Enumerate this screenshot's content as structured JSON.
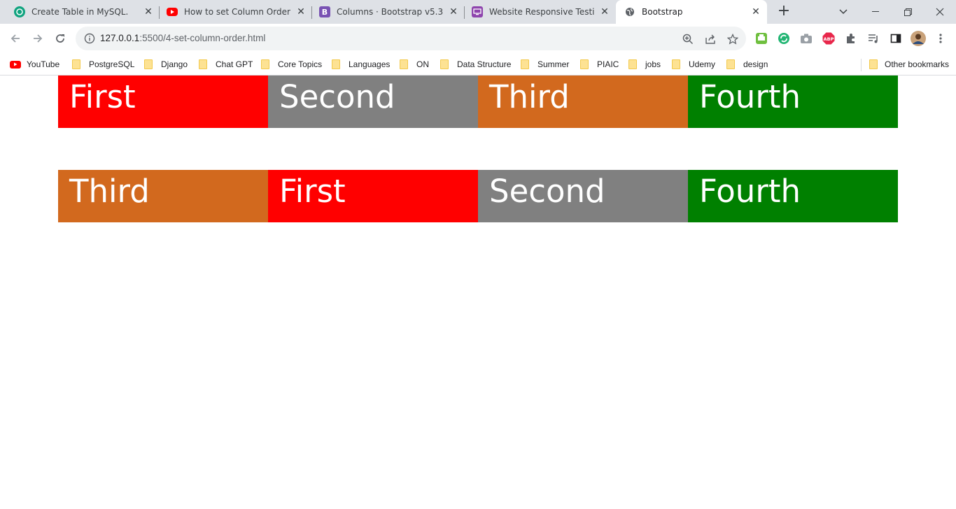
{
  "browser": {
    "tabs": [
      {
        "title": "Create Table in MySQL.",
        "icon": "chatgpt-icon",
        "active": false
      },
      {
        "title": "How to set Column Order in Bootstrap",
        "icon": "youtube-icon",
        "active": false
      },
      {
        "title": "Columns · Bootstrap v5.3",
        "icon": "bootstrap-icon",
        "active": false
      },
      {
        "title": "Website Responsive Testing Tool",
        "icon": "responsive-tester-icon",
        "active": false
      },
      {
        "title": "Bootstrap",
        "icon": "globe-icon",
        "active": true
      }
    ],
    "address": {
      "host": "127.0.0.1",
      "rest": ":5500/4-set-column-order.html"
    },
    "bookmarks": [
      {
        "label": "YouTube",
        "icon": "youtube-icon"
      },
      {
        "label": "PostgreSQL",
        "icon": "folder-icon"
      },
      {
        "label": "Django",
        "icon": "folder-icon"
      },
      {
        "label": "Chat GPT",
        "icon": "folder-icon"
      },
      {
        "label": "Core Topics",
        "icon": "folder-icon"
      },
      {
        "label": "Languages",
        "icon": "folder-icon"
      },
      {
        "label": "ON",
        "icon": "folder-icon"
      },
      {
        "label": "Data Structure",
        "icon": "folder-icon"
      },
      {
        "label": "Summer",
        "icon": "folder-icon"
      },
      {
        "label": "PIAIC",
        "icon": "folder-icon"
      },
      {
        "label": "jobs",
        "icon": "folder-icon"
      },
      {
        "label": "Udemy",
        "icon": "folder-icon"
      },
      {
        "label": "design",
        "icon": "folder-icon"
      }
    ],
    "other_bookmarks": "Other bookmarks"
  },
  "page": {
    "rows": [
      {
        "cols": [
          {
            "label": "First",
            "color": "#ff0000"
          },
          {
            "label": "Second",
            "color": "#808080"
          },
          {
            "label": "Third",
            "color": "#d2691e"
          },
          {
            "label": "Fourth",
            "color": "#008000"
          }
        ]
      },
      {
        "cols": [
          {
            "label": "Third",
            "color": "#d2691e"
          },
          {
            "label": "First",
            "color": "#ff0000"
          },
          {
            "label": "Second",
            "color": "#808080"
          },
          {
            "label": "Fourth",
            "color": "#008000"
          }
        ]
      }
    ]
  }
}
